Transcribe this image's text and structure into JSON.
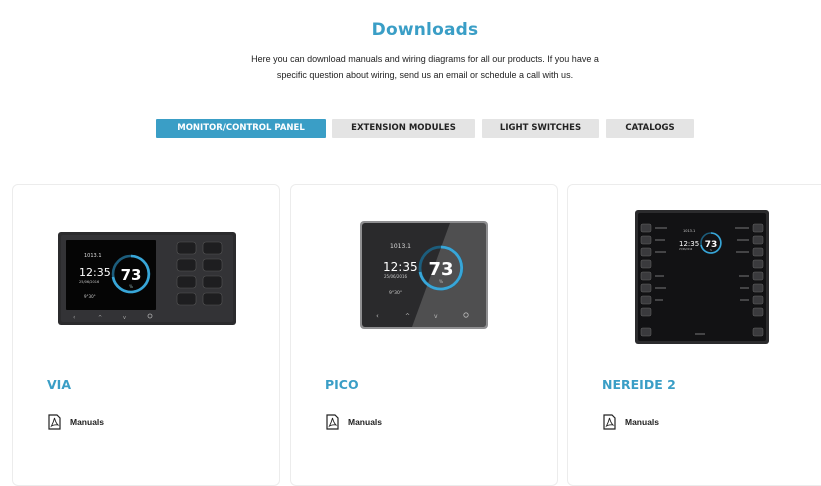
{
  "page": {
    "title": "Downloads",
    "intro_line1": "Here you can download manuals and wiring diagrams for all our products. If you have a",
    "intro_line2": "specific question about wiring, send us an email or schedule a call with us."
  },
  "tabs": [
    {
      "label": "MONITOR/CONTROL PANEL",
      "active": true
    },
    {
      "label": "EXTENSION MODULES",
      "active": false
    },
    {
      "label": "LIGHT SWITCHES",
      "active": false
    },
    {
      "label": "CATALOGS",
      "active": false
    }
  ],
  "products": [
    {
      "name": "VIA",
      "manuals_label": "Manuals",
      "icon": "pdf-icon",
      "screen": {
        "pressure": "1013.1",
        "time": "12:35",
        "date": "25/06/2016",
        "value": "73",
        "unit": "%",
        "temp": "9°30°"
      }
    },
    {
      "name": "PICO",
      "manuals_label": "Manuals",
      "icon": "pdf-icon",
      "screen": {
        "pressure": "1013.1",
        "time": "12:35",
        "date": "25/06/2016",
        "value": "73",
        "unit": "%",
        "temp": "9°30°"
      }
    },
    {
      "name": "NEREIDE 2",
      "manuals_label": "Manuals",
      "icon": "pdf-icon",
      "screen": {
        "pressure": "1013.1",
        "time": "12:35",
        "date": "25/06/2016",
        "value": "73",
        "unit": "%"
      }
    }
  ],
  "colors": {
    "accent": "#3a9ec6",
    "tab_inactive": "#e4e4e4",
    "device_body": "#2b2b2d"
  }
}
